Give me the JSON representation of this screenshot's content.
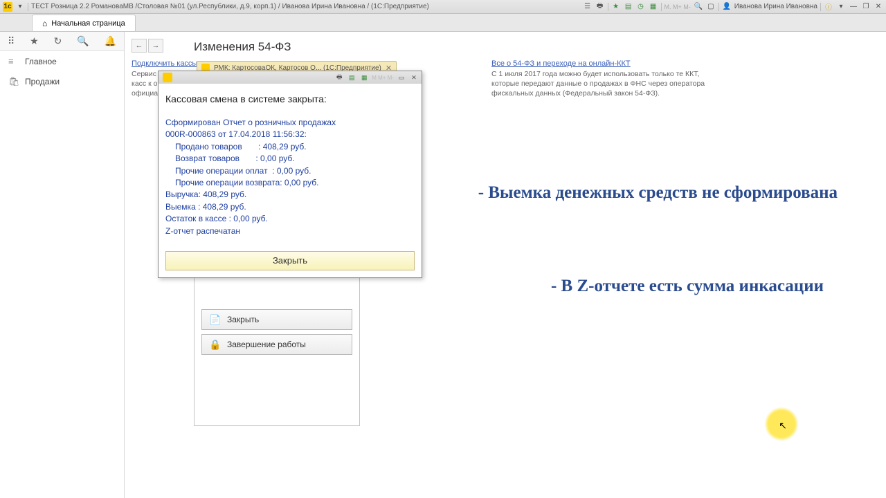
{
  "titlebar": {
    "title": "ТЕСТ Розница 2.2 РомановаМВ /Столовая №01 (ул.Республики, д.9, корп.1) / Иванова Ирина Ивановна /  (1С:Предприятие)",
    "user": "Иванова Ирина Ивановна"
  },
  "maintab": {
    "label": "Начальная страница"
  },
  "sidebar": {
    "items": [
      {
        "label": "Главное"
      },
      {
        "label": "Продажи"
      }
    ]
  },
  "page": {
    "title": "Изменения 54-ФЗ"
  },
  "left_block": {
    "link": "Подключить кассы к",
    "text": "Сервис\nкасс к о\nофициал"
  },
  "right_block": {
    "link": "Все о 54-ФЗ и переходе на онлайн-ККТ",
    "text": "С 1 июля 2017 года можно будет использовать только те ККТ, которые передают данные о продажах в ФНС через оператора фискальных данных (Федеральный закон 54-ФЗ)."
  },
  "inner_tab": {
    "label": "РМК: КартосоваОК, Картосов О... (1С:Предприятие)"
  },
  "bg_panel": {
    "btn1": "Закрыть",
    "btn2": "Завершение работы"
  },
  "modal": {
    "heading": "Кассовая смена в системе закрыта:",
    "line1": "Сформирован Отчет о розничных продажах",
    "line2": "000R-000863 от 17.04.2018 11:56:32:",
    "sold_label": "Продано товаров",
    "sold_value": ": 408,29 руб.",
    "ret_label": "Возврат товаров",
    "ret_value": ": 0,00 руб.",
    "op_pay_label": "Прочие операции оплат",
    "op_pay_value": ": 0,00 руб.",
    "op_ret_label": "Прочие операции возврата:",
    "op_ret_value": " 0,00 руб.",
    "revenue": "Выручка: 408,29 руб.",
    "withdraw": "Выемка        : 408,29 руб.",
    "balance": "Остаток в кассе : 0,00 руб.",
    "zreport": "Z-отчет распечатан",
    "close_btn": "Закрыть"
  },
  "annotations": {
    "a1": "- Выемка денежных средств не сформирована",
    "a2": "- В Z-отчете есть сумма инкасации"
  }
}
